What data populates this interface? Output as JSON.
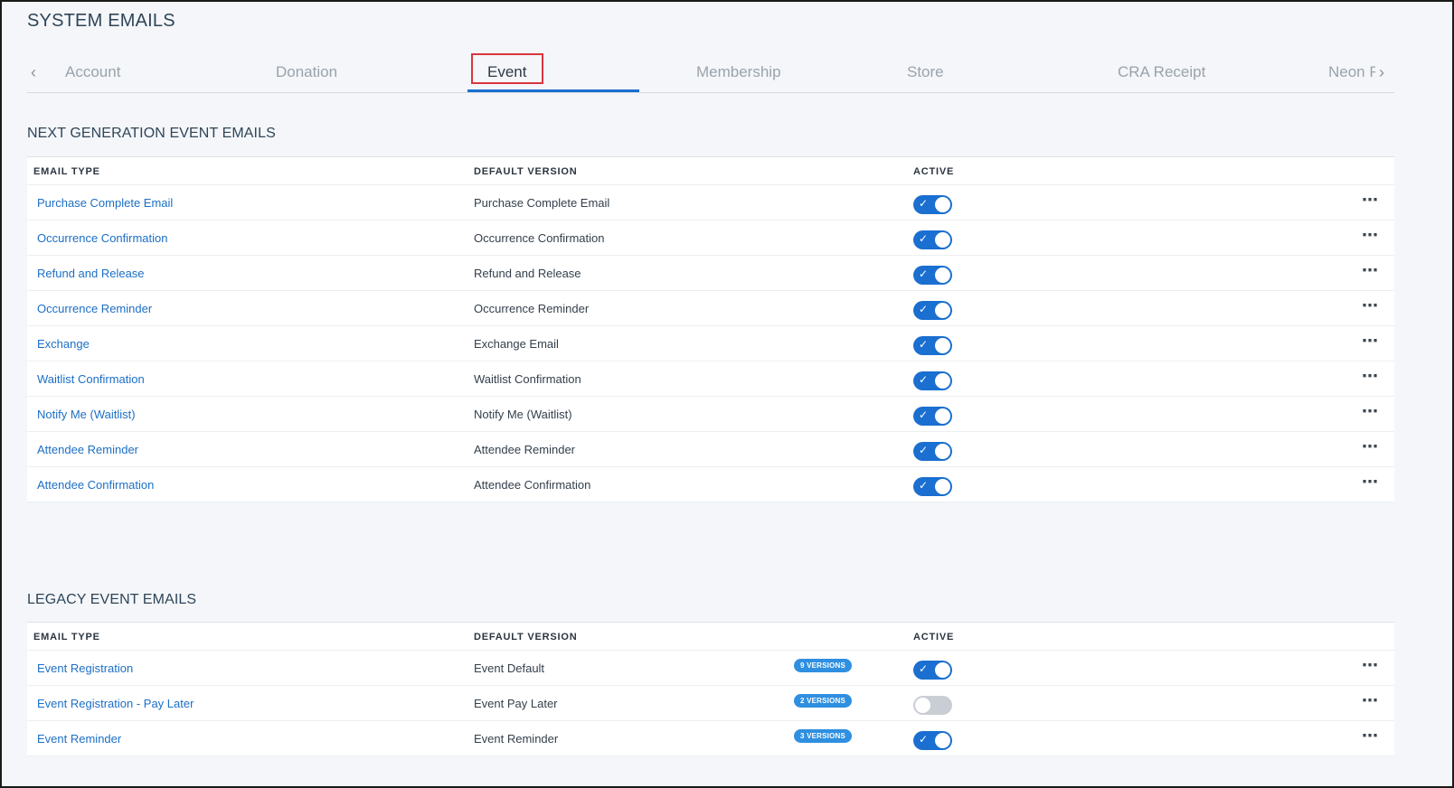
{
  "page": {
    "title": "SYSTEM EMAILS"
  },
  "tabs": {
    "prev_icon": "chevron-left-icon",
    "next_icon": "chevron-right-icon",
    "items": [
      {
        "label": "Account"
      },
      {
        "label": "Donation"
      },
      {
        "label": "Event",
        "active": true
      },
      {
        "label": "Membership"
      },
      {
        "label": "Store"
      },
      {
        "label": "CRA Receipt"
      },
      {
        "label": "Neon F"
      }
    ]
  },
  "next_gen": {
    "title": "NEXT GENERATION EVENT EMAILS",
    "headers": {
      "email_type": "EMAIL TYPE",
      "default_version": "DEFAULT VERSION",
      "active": "ACTIVE"
    },
    "rows": [
      {
        "email_type": "Purchase Complete Email",
        "default_version": "Purchase Complete Email",
        "active": true
      },
      {
        "email_type": "Occurrence Confirmation",
        "default_version": "Occurrence Confirmation",
        "active": true
      },
      {
        "email_type": "Refund and Release",
        "default_version": "Refund and Release",
        "active": true
      },
      {
        "email_type": "Occurrence Reminder",
        "default_version": "Occurrence Reminder",
        "active": true
      },
      {
        "email_type": "Exchange",
        "default_version": "Exchange Email",
        "active": true
      },
      {
        "email_type": "Waitlist Confirmation",
        "default_version": "Waitlist Confirmation",
        "active": true
      },
      {
        "email_type": "Notify Me (Waitlist)",
        "default_version": "Notify Me (Waitlist)",
        "active": true
      },
      {
        "email_type": "Attendee Reminder",
        "default_version": "Attendee Reminder",
        "active": true
      },
      {
        "email_type": "Attendee Confirmation",
        "default_version": "Attendee Confirmation",
        "active": true
      }
    ]
  },
  "legacy": {
    "title": "LEGACY EVENT EMAILS",
    "headers": {
      "email_type": "EMAIL TYPE",
      "default_version": "DEFAULT VERSION",
      "active": "ACTIVE"
    },
    "rows": [
      {
        "email_type": "Event Registration",
        "default_version": "Event Default",
        "versions": "9 VERSIONS",
        "active": true
      },
      {
        "email_type": "Event Registration - Pay Later",
        "default_version": "Event Pay Later",
        "versions": "2 VERSIONS",
        "active": false
      },
      {
        "email_type": "Event Reminder",
        "default_version": "Event Reminder",
        "versions": "3 VERSIONS",
        "active": true
      }
    ]
  },
  "icons": {
    "more": "more-horizontal-icon",
    "check": "check-icon"
  },
  "colors": {
    "accent": "#1a6fd0",
    "link": "#1c6fc6",
    "highlight": "#d9363e",
    "badge": "#2f8fe0"
  }
}
